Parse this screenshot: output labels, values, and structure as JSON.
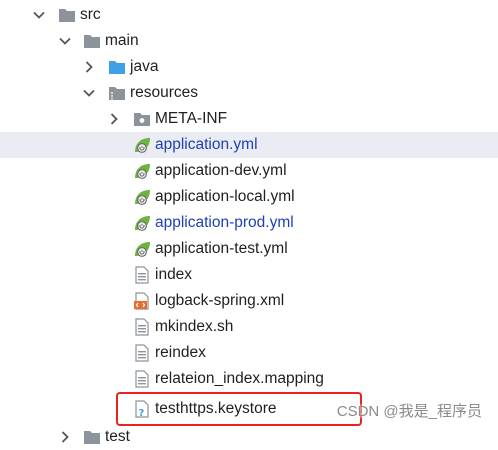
{
  "tree": {
    "src": "src",
    "main": "main",
    "java": "java",
    "resources": "resources",
    "meta_inf": "META-INF",
    "application_yml": "application.yml",
    "application_dev_yml": "application-dev.yml",
    "application_local_yml": "application-local.yml",
    "application_prod_yml": "application-prod.yml",
    "application_test_yml": "application-test.yml",
    "index": "index",
    "logback_spring_xml": "logback-spring.xml",
    "mkindex_sh": "mkindex.sh",
    "reindex": "reindex",
    "relateion_index_mapping": "relateion_index.mapping",
    "testhttps_keystore": "testhttps.keystore",
    "partial_next": "test"
  },
  "watermark": "CSDN @我是_程序员",
  "colors": {
    "selected_bg": "#e9edf3",
    "modified_file_text": "#1f3fb5",
    "highlight_border": "#e8231c",
    "spring_green": "#6db33f"
  },
  "icons": {
    "collapse": "chevron-down-icon",
    "expand": "chevron-right-icon",
    "folder": "folder-icon",
    "source_folder": "source-folder-icon",
    "resources_folder": "resources-folder-icon",
    "spring_config": "spring-config-icon",
    "text_file": "text-file-icon",
    "xml_file": "xml-file-icon",
    "unknown_file": "unknown-file-icon"
  }
}
